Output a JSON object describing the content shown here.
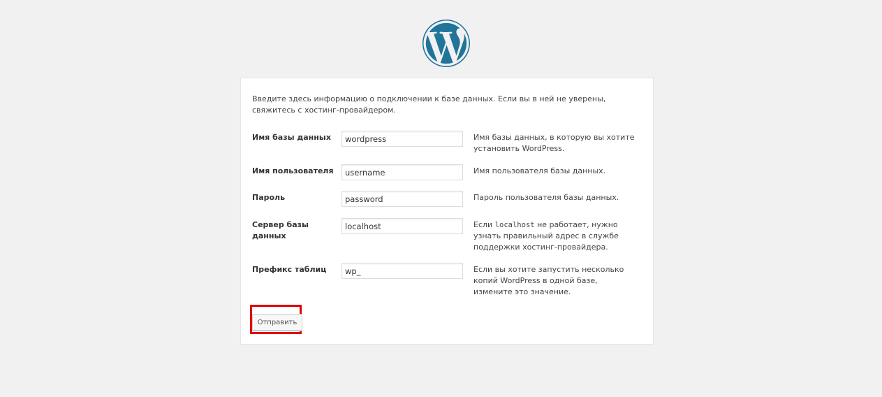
{
  "logo": {
    "icon": "wordpress-logo",
    "color": "#21759b"
  },
  "intro": "Введите здесь информацию о подключении к базе данных. Если вы в ней не уверены, свяжитесь с хостинг-провайдером.",
  "fields": {
    "dbname": {
      "label": "Имя базы данных",
      "value": "wordpress",
      "description": "Имя базы данных, в которую вы хотите установить WordPress."
    },
    "username": {
      "label": "Имя пользователя",
      "value": "username",
      "description": "Имя пользователя базы данных."
    },
    "password": {
      "label": "Пароль",
      "value": "password",
      "description": "Пароль пользователя базы данных."
    },
    "host": {
      "label": "Сервер базы данных",
      "value": "localhost",
      "description_prefix": "Если ",
      "description_code": "localhost",
      "description_suffix": " не работает, нужно узнать правильный адрес в службе поддержки хостинг-провайдера."
    },
    "prefix": {
      "label": "Префикс таблиц",
      "value": "wp_",
      "description": "Если вы хотите запустить несколько копий WordPress в одной базе, измените это значение."
    }
  },
  "submit_label": "Отправить",
  "highlight_color": "#e00000"
}
